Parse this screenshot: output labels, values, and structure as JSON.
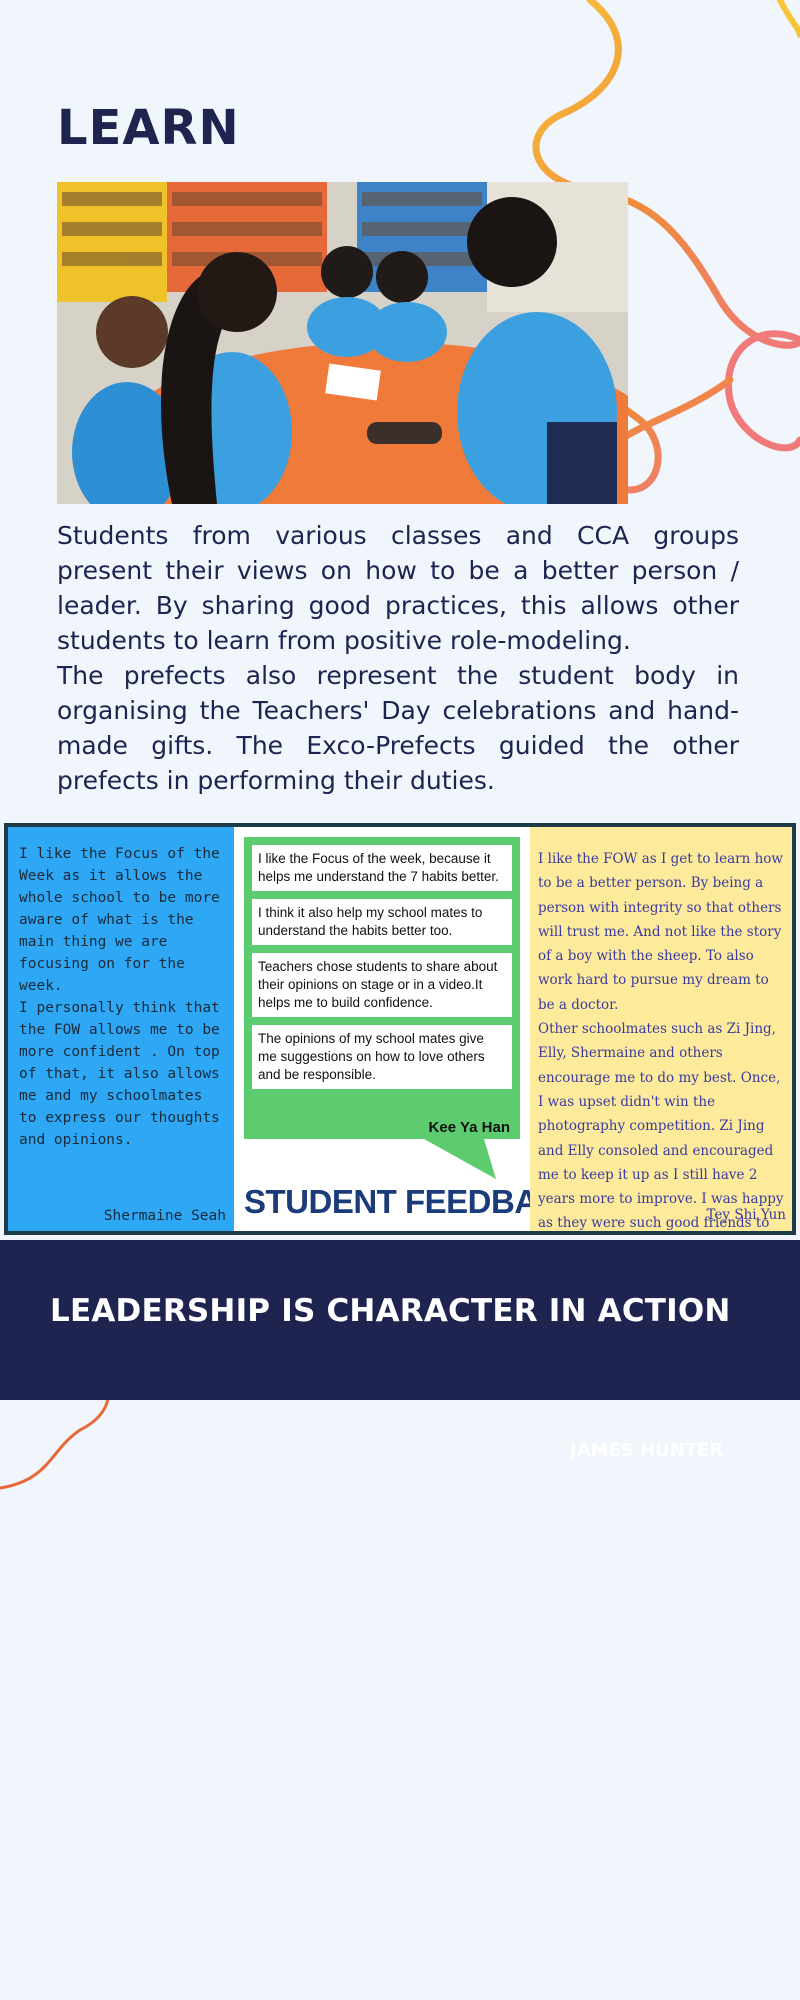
{
  "page": {
    "title": "LEARN",
    "paragraphs": [
      "Students from various classes and CCA groups present their views on how to be a better person / leader. By sharing good practices, this allows other students to learn from positive role-modeling.",
      "The prefects also represent the student body in organising the Teachers' Day celebrations and hand-made gifts. The Exco-Prefects guided the other prefects in performing their duties."
    ]
  },
  "feedback": {
    "left": {
      "text": "I like the Focus of the Week as it allows the whole school to be more aware of what is the main thing we are focusing on for the week.\nI personally think that the FOW allows me to be more confident . On top of that, it also allows me and my schoolmates to express our thoughts and opinions.",
      "signature": "Shermaine Seah"
    },
    "middle": {
      "cards": [
        "I like the Focus of the week, because it helps me understand the 7 habits better.",
        "I think it also help my school mates to understand the habits better too.",
        "Teachers chose students to share about their opinions on stage or in a video.It helps me to build confidence.",
        "The opinions of my school mates give me suggestions on how to love others and be responsible."
      ],
      "signature": "Kee Ya Han",
      "title": "STUDENT FEEDBACK"
    },
    "right": {
      "text": "I like the FOW as I get to learn how to be a better person. By being a person with integrity so that others will trust me. And not like the story of a boy with the sheep. To also work hard to pursue my dream to be a doctor.\nOther schoolmates such as Zi Jing, Elly, Shermaine and others encourage me to do my best. Once, I was upset  didn't win the photography competition. Zi Jing and Elly consoled and encouraged me to keep it up as I still have 2 years more to improve. I was happy as they were such good friends to me.",
      "signature": "Tey Shi Yun"
    }
  },
  "band": {
    "quote": "LEADERSHIP IS CHARACTER IN ACTION",
    "author": "JAMES HUNTER"
  },
  "colors": {
    "navy": "#1f2350",
    "background": "#f0f6fc",
    "blue_panel": "#2ea8f5",
    "yellow_panel": "#fdeb9b",
    "green_bubble": "#5ccc6e",
    "ribbon_yellow": "#f7b733",
    "ribbon_orange": "#f08a3c",
    "ribbon_pink": "#f07a7a"
  }
}
